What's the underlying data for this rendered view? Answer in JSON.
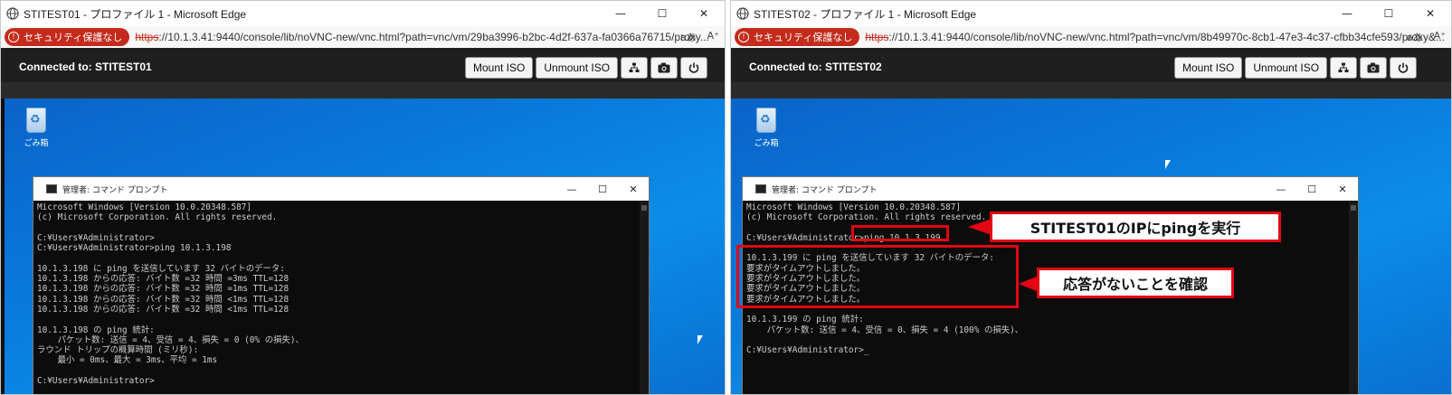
{
  "windows": [
    {
      "title": "STITEST01 - プロファイル 1 - Microsoft Edge",
      "security_badge": "セキュリティ保護なし",
      "url_scheme": "https",
      "url_rest": "://10.1.3.41:9440/console/lib/noVNC-new/vnc.html?path=vnc/vm/29ba3996-b2bc-4d2f-637a-fa0366a76715/proxy...",
      "controls": {
        "minimize": "—",
        "maximize": "☐",
        "close": "✕"
      },
      "addr_icons": {
        "read_aloud": "aあ",
        "text_size": "A⁺"
      },
      "vnc": {
        "connected": "Connected to: STITEST01",
        "mount_iso": "Mount ISO",
        "unmount_iso": "Unmount ISO"
      },
      "recycle_label": "ごみ箱",
      "cmd": {
        "title": "管理者: コマンド プロンプト",
        "lines": [
          "Microsoft Windows [Version 10.0.20348.587]",
          "(c) Microsoft Corporation. All rights reserved.",
          "",
          "C:¥Users¥Administrator>",
          "C:¥Users¥Administrator>ping 10.1.3.198",
          "",
          "10.1.3.198 に ping を送信しています 32 バイトのデータ:",
          "10.1.3.198 からの応答: バイト数 =32 時間 =3ms TTL=128",
          "10.1.3.198 からの応答: バイト数 =32 時間 =1ms TTL=128",
          "10.1.3.198 からの応答: バイト数 =32 時間 <1ms TTL=128",
          "10.1.3.198 からの応答: バイト数 =32 時間 <1ms TTL=128",
          "",
          "10.1.3.198 の ping 統計:",
          "    パケット数: 送信 = 4、受信 = 4、損失 = 0 (0% の損失)、",
          "ラウンド トリップの概算時間 (ミリ秒):",
          "    最小 = 0ms、最大 = 3ms、平均 = 1ms",
          "",
          "C:¥Users¥Administrator>"
        ]
      }
    },
    {
      "title": "STITEST02 - プロファイル 1 - Microsoft Edge",
      "security_badge": "セキュリティ保護なし",
      "url_scheme": "https",
      "url_rest": "://10.1.3.41:9440/console/lib/noVNC-new/vnc.html?path=vnc/vm/8b49970c-8cb1-47e3-4c37-cfbb34cfe593/proxy&...",
      "controls": {
        "minimize": "—",
        "maximize": "☐",
        "close": "✕"
      },
      "addr_icons": {
        "read_aloud": "aあ",
        "text_size": "A⁺"
      },
      "vnc": {
        "connected": "Connected to: STITEST02",
        "mount_iso": "Mount ISO",
        "unmount_iso": "Unmount ISO"
      },
      "recycle_label": "ごみ箱",
      "cmd": {
        "title": "管理者: コマンド プロンプト",
        "lines": [
          "Microsoft Windows [Version 10.0.20348.587]",
          "(c) Microsoft Corporation. All rights reserved.",
          "",
          "C:¥Users¥Administrator>ping 10.1.3.199",
          "",
          "10.1.3.199 に ping を送信しています 32 バイトのデータ:",
          "要求がタイムアウトしました。",
          "要求がタイムアウトしました。",
          "要求がタイムアウトしました。",
          "要求がタイムアウトしました。",
          "",
          "10.1.3.199 の ping 統計:",
          "    パケット数: 送信 = 4、受信 = 0、損失 = 4 (100% の損失)、",
          "",
          "C:¥Users¥Administrator>_"
        ]
      }
    }
  ],
  "annotations": {
    "callout_ping": "STITEST01のIPにpingを実行",
    "callout_noreply": "応答がないことを確認"
  },
  "colors": {
    "annotation_red": "#e30613",
    "security_red": "#c42b1c"
  }
}
